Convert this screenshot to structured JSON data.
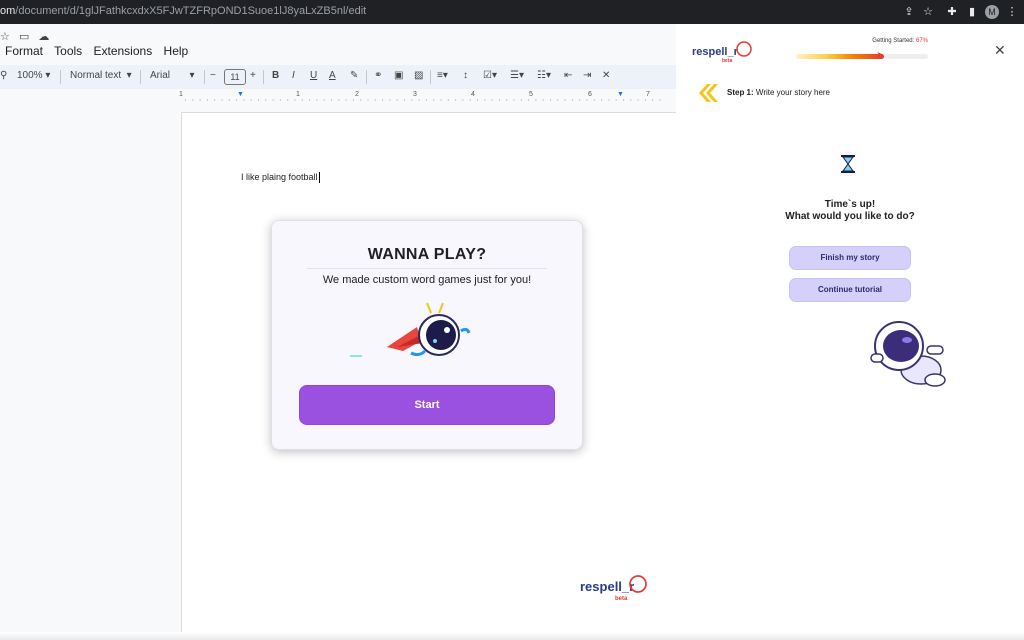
{
  "browser": {
    "url_prefix": "om",
    "url_path": "/document/d/1glJFathkcxdxX5FJwTZFRpOND1Suoe1lJ8yaLxZB5nl/edit",
    "avatar_letter": "M"
  },
  "docs": {
    "menu": [
      "Format",
      "Tools",
      "Extensions",
      "Help"
    ],
    "toolbar": {
      "zoom": "100%",
      "style": "Normal text",
      "font": "Arial",
      "font_size": "11"
    },
    "ruler_numbers": [
      "1",
      "1",
      "2",
      "3",
      "4",
      "5",
      "6",
      "7"
    ],
    "document_text": "I like plaing football"
  },
  "modal": {
    "title": "WANNA PLAY?",
    "subtitle": "We made custom word games just for you!",
    "start_label": "Start"
  },
  "sidebar": {
    "logo_text": "respell_r",
    "logo_badge": "beta",
    "progress": {
      "label": "Getting Started:",
      "percent_text": "67%",
      "value": 0.67
    },
    "step": {
      "prefix": "Step 1:",
      "text": "Write your story here"
    },
    "timesup_line1": "Time`s up!",
    "timesup_line2": "What would you like to do?",
    "finish_label": "Finish my story",
    "tutorial_label": "Continue tutorial"
  },
  "footer_logo": {
    "text": "respell_r",
    "badge": "beta"
  },
  "colors": {
    "accent_purple": "#9b51e0",
    "side_button": "#d4d0fb",
    "progress_red": "#e53935",
    "step_arrow": "#f5c518"
  }
}
